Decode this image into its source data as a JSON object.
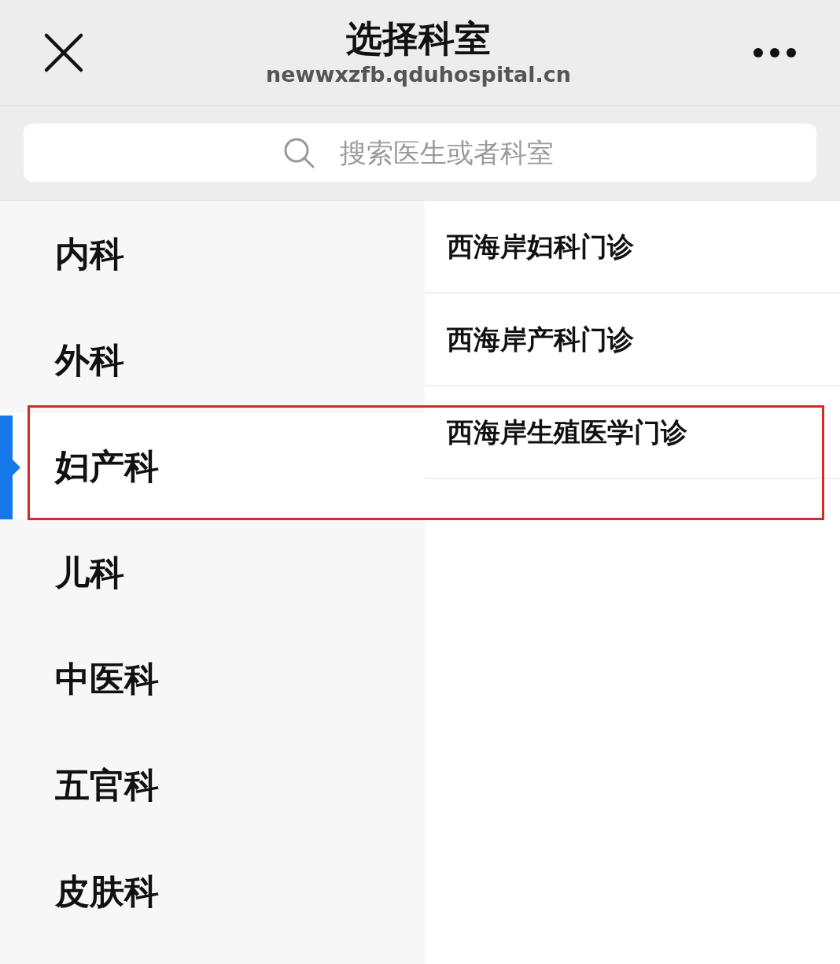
{
  "header": {
    "title": "选择科室",
    "url": "newwxzfb.qduhospital.cn"
  },
  "search": {
    "placeholder": "搜索医生或者科室"
  },
  "departments": [
    {
      "label": "内科",
      "selected": false
    },
    {
      "label": "外科",
      "selected": false
    },
    {
      "label": "妇产科",
      "selected": true
    },
    {
      "label": "儿科",
      "selected": false
    },
    {
      "label": "中医科",
      "selected": false
    },
    {
      "label": "五官科",
      "selected": false
    },
    {
      "label": "皮肤科",
      "selected": false
    }
  ],
  "clinics": [
    {
      "label": "西海岸妇科门诊"
    },
    {
      "label": "西海岸产科门诊"
    },
    {
      "label": "西海岸生殖医学门诊"
    }
  ]
}
